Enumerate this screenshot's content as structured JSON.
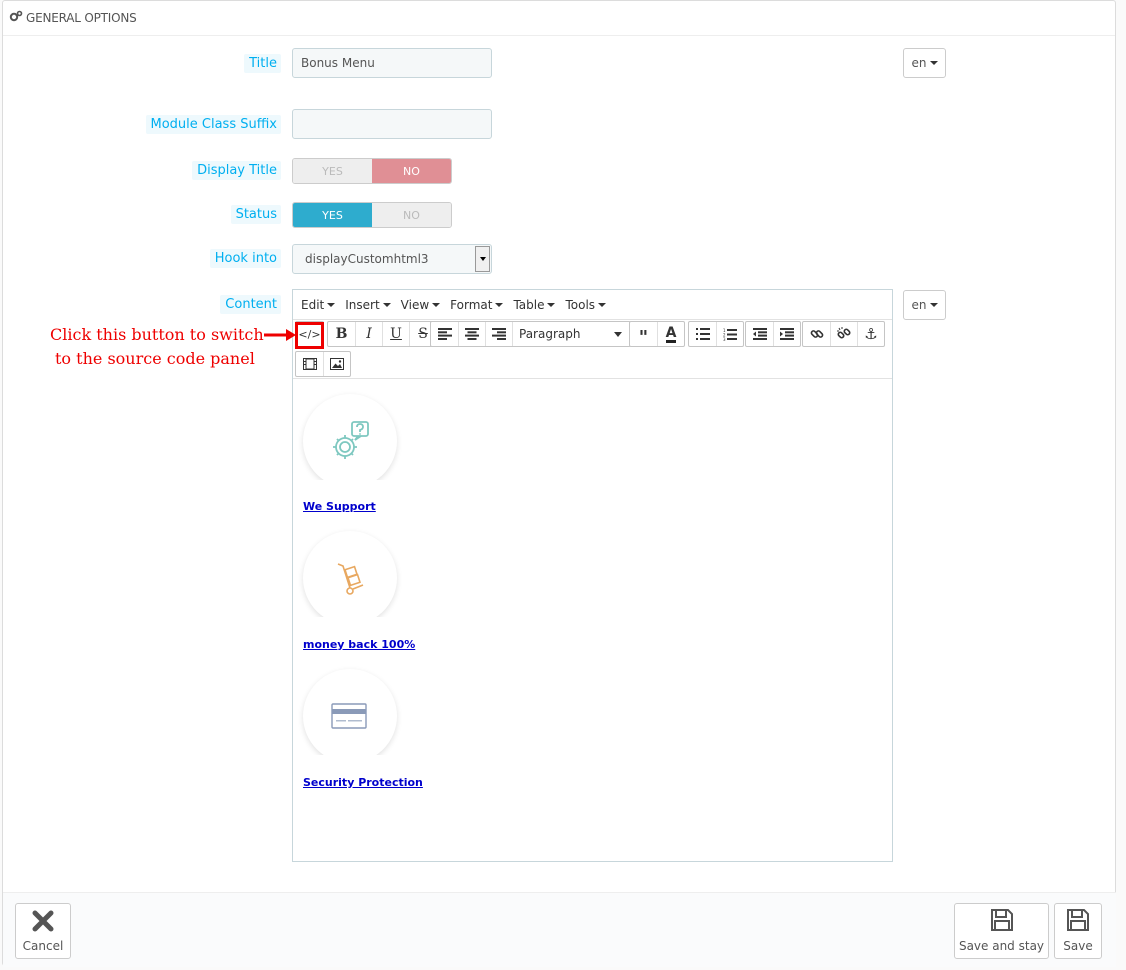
{
  "panel": {
    "heading": "GENERAL OPTIONS"
  },
  "form": {
    "title": {
      "label": "Title",
      "value": "Bonus Menu",
      "lang": "en"
    },
    "module_class_suffix": {
      "label": "Module Class Suffix",
      "value": ""
    },
    "display_title": {
      "label": "Display Title",
      "yes": "YES",
      "no": "NO",
      "selected": "NO"
    },
    "status": {
      "label": "Status",
      "yes": "YES",
      "no": "NO",
      "selected": "YES"
    },
    "hook_into": {
      "label": "Hook into",
      "value": "displayCustomhtml3"
    },
    "content": {
      "label": "Content",
      "lang": "en"
    }
  },
  "editor": {
    "menus": [
      "Edit",
      "Insert",
      "View",
      "Format",
      "Table",
      "Tools"
    ],
    "format_select": "Paragraph",
    "items": [
      {
        "icon": "gear-question-icon",
        "link": "We Support",
        "color": "#7ec8c0"
      },
      {
        "icon": "hand-truck-icon",
        "link": "money back 100%",
        "color": "#e8a860"
      },
      {
        "icon": "credit-card-icon",
        "link": "Security Protection",
        "color": "#8a9ab8"
      }
    ]
  },
  "annotation": {
    "line1": "Click this button to switch",
    "line2": "to the source code panel",
    "color": "#e00000"
  },
  "footer": {
    "cancel": "Cancel",
    "save_and_stay": "Save and stay",
    "save": "Save"
  }
}
